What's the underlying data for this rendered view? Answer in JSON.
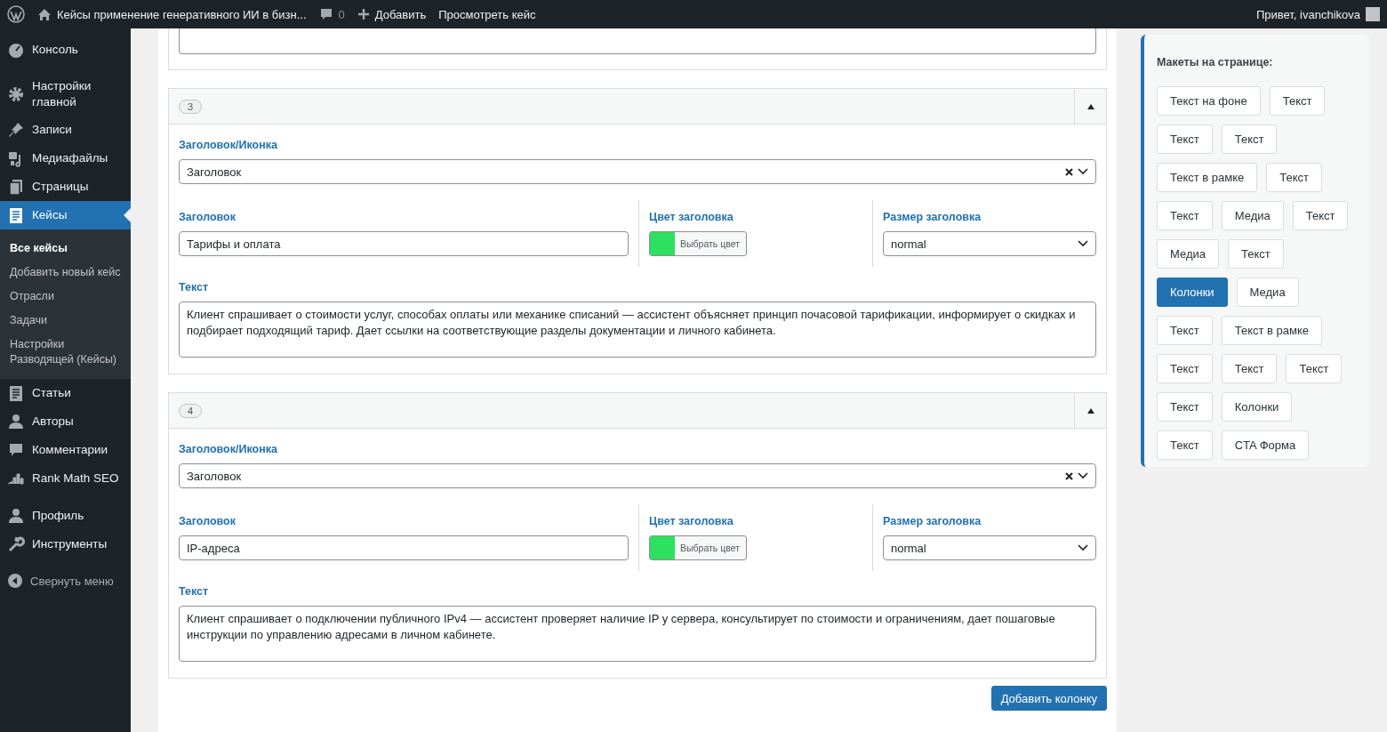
{
  "admin_bar": {
    "site_title": "Кейсы применение генеративного ИИ в бизн...",
    "comments": "0",
    "new_label": "Добавить",
    "view_label": "Просмотреть кейс",
    "greeting": "Привет, ivanchikova"
  },
  "sidebar": {
    "groups": [
      [
        {
          "label": "Консоль",
          "selected": false
        }
      ],
      [
        {
          "label": "Настройки главной",
          "selected": false
        },
        {
          "label": "Записи",
          "selected": false
        },
        {
          "label": "Медиафайлы",
          "selected": false
        },
        {
          "label": "Страницы",
          "selected": false
        },
        {
          "label": "Кейсы",
          "selected": true,
          "children": [
            {
              "label": "Все кейсы",
              "selected": true
            },
            {
              "label": "Добавить новый кейс",
              "selected": false
            },
            {
              "label": "Отрасли",
              "selected": false
            },
            {
              "label": "Задачи",
              "selected": false
            },
            {
              "label": "Настройки Разводящей (Кейсы)",
              "selected": false
            }
          ]
        },
        {
          "label": "Статьи",
          "selected": false
        },
        {
          "label": "Авторы",
          "selected": false
        },
        {
          "label": "Комментарии",
          "selected": false
        },
        {
          "label": "Rank Math SEO",
          "selected": false
        }
      ],
      [
        {
          "label": "Профиль",
          "selected": false
        },
        {
          "label": "Инструменты",
          "selected": false
        }
      ]
    ],
    "collapse": "Свернуть меню"
  },
  "rows": [
    {
      "number": "3",
      "expanded": true,
      "heading_icon_label": "Заголовок/Иконка",
      "heading_icon_value": "Заголовок",
      "heading_label": "Заголовок",
      "heading_value": "Тарифы и оплата",
      "color_label": "Цвет заголовка",
      "color": "#2ee05f",
      "color_button": "Выбрать цвет",
      "size_label": "Размер заголовка",
      "size_value": "normal",
      "text_label": "Текст",
      "text_value": "Клиент спрашивает о стоимости услуг, способах оплаты или механике списаний — ассистент объясняет принцип почасовой тарификации, информирует о скидках и подбирает подходящий тариф. Дает ссылки на соответствующие разделы документации и личного кабинета."
    },
    {
      "number": "4",
      "expanded": true,
      "heading_icon_label": "Заголовок/Иконка",
      "heading_icon_value": "Заголовок",
      "heading_label": "Заголовок",
      "heading_value": "IP-адреса",
      "color_label": "Цвет заголовка",
      "color": "#2ee05f",
      "color_button": "Выбрать цвет",
      "size_label": "Размер заголовка",
      "size_value": "normal",
      "text_label": "Текст",
      "text_value": "Клиент спрашивает о подключении публичного IPv4 — ассистент проверяет наличие IP у сервера, консультирует по стоимости и ограничениям, дает пошаговые инструкции по управлению адресами в личном кабинете."
    }
  ],
  "add_button": "Добавить колонку",
  "layouts_panel": {
    "title": "Макеты на странице:",
    "rows": [
      [
        {
          "label": "Текст на фоне",
          "selected": false
        },
        {
          "label": "Текст",
          "selected": false
        }
      ],
      [
        {
          "label": "Текст",
          "selected": false
        },
        {
          "label": "Текст",
          "selected": false
        }
      ],
      [
        {
          "label": "Текст в рамке",
          "selected": false
        },
        {
          "label": "Текст",
          "selected": false
        }
      ],
      [
        {
          "label": "Текст",
          "selected": false
        },
        {
          "label": "Медиа",
          "selected": false
        },
        {
          "label": "Текст",
          "selected": false
        }
      ],
      [
        {
          "label": "Медиа",
          "selected": false
        },
        {
          "label": "Текст",
          "selected": false
        }
      ],
      [
        {
          "label": "Колонки",
          "selected": true
        },
        {
          "label": "Медиа",
          "selected": false
        }
      ],
      [
        {
          "label": "Текст",
          "selected": false
        },
        {
          "label": "Текст в рамке",
          "selected": false
        }
      ],
      [
        {
          "label": "Текст",
          "selected": false
        },
        {
          "label": "Текст",
          "selected": false
        },
        {
          "label": "Текст",
          "selected": false
        }
      ],
      [
        {
          "label": "Текст",
          "selected": false
        },
        {
          "label": "Колонки",
          "selected": false
        }
      ],
      [
        {
          "label": "Текст",
          "selected": false
        },
        {
          "label": "CTA Форма",
          "selected": false
        }
      ]
    ]
  }
}
